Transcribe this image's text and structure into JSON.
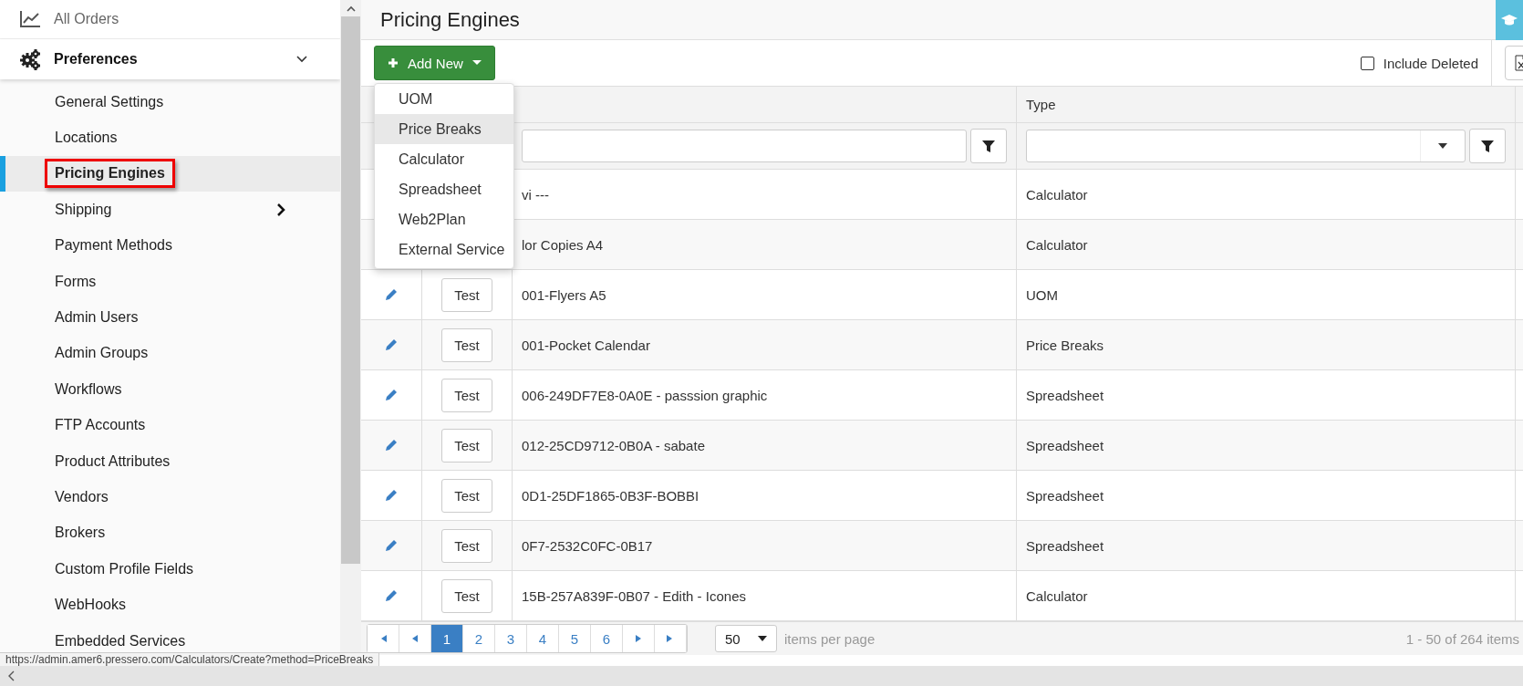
{
  "sidebar": {
    "top_item": {
      "label": "All Orders"
    },
    "section": {
      "label": "Preferences",
      "expanded": true
    },
    "items": [
      {
        "label": "General Settings",
        "selected": false
      },
      {
        "label": "Locations",
        "selected": false
      },
      {
        "label": "Pricing Engines",
        "selected": true,
        "highlighted": true
      },
      {
        "label": "Shipping",
        "selected": false,
        "has_submenu": true
      },
      {
        "label": "Payment Methods",
        "selected": false
      },
      {
        "label": "Forms",
        "selected": false
      },
      {
        "label": "Admin Users",
        "selected": false
      },
      {
        "label": "Admin Groups",
        "selected": false
      },
      {
        "label": "Workflows",
        "selected": false
      },
      {
        "label": "FTP Accounts",
        "selected": false
      },
      {
        "label": "Product Attributes",
        "selected": false
      },
      {
        "label": "Vendors",
        "selected": false
      },
      {
        "label": "Brokers",
        "selected": false
      },
      {
        "label": "Custom Profile Fields",
        "selected": false
      },
      {
        "label": "WebHooks",
        "selected": false
      },
      {
        "label": "Embedded Services",
        "selected": false
      }
    ]
  },
  "page": {
    "title": "Pricing Engines"
  },
  "toolbar": {
    "add_button": "Add New",
    "include_deleted": {
      "label": "Include Deleted",
      "checked": false
    }
  },
  "add_menu": {
    "items": [
      {
        "label": "UOM",
        "hovered": false
      },
      {
        "label": "Price Breaks",
        "hovered": true
      },
      {
        "label": "Calculator",
        "hovered": false
      },
      {
        "label": "Spreadsheet",
        "hovered": false
      },
      {
        "label": "Web2Plan",
        "hovered": false
      },
      {
        "label": "External Service",
        "hovered": false
      }
    ]
  },
  "table": {
    "type_column": {
      "label": "Type"
    },
    "rows": [
      {
        "name": "vi ---",
        "type": "Calculator"
      },
      {
        "name": "lor Copies A4",
        "type": "Calculator"
      },
      {
        "test": "Test",
        "name": "001-Flyers A5",
        "type": "UOM"
      },
      {
        "test": "Test",
        "name": "001-Pocket Calendar",
        "type": "Price Breaks"
      },
      {
        "test": "Test",
        "name": "006-249DF7E8-0A0E - passsion graphic",
        "type": "Spreadsheet"
      },
      {
        "test": "Test",
        "name": "012-25CD9712-0B0A - sabate",
        "type": "Spreadsheet"
      },
      {
        "test": "Test",
        "name": "0D1-25DF1865-0B3F-BOBBI",
        "type": "Spreadsheet"
      },
      {
        "test": "Test",
        "name": "0F7-2532C0FC-0B17",
        "type": "Spreadsheet"
      },
      {
        "test": "Test",
        "name": "15B-257A839F-0B07 - Edith - Icones",
        "type": "Calculator"
      }
    ]
  },
  "pager": {
    "pages": [
      {
        "label": "1",
        "selected": true
      },
      {
        "label": "2",
        "selected": false
      },
      {
        "label": "3",
        "selected": false
      },
      {
        "label": "4",
        "selected": false
      },
      {
        "label": "5",
        "selected": false
      },
      {
        "label": "6",
        "selected": false
      }
    ],
    "page_size": "50",
    "page_size_label": "items per page",
    "summary": "1 - 50 of 264 items"
  },
  "status_url": "https://admin.amer6.pressero.com/Calculators/Create?method=PriceBreaks"
}
